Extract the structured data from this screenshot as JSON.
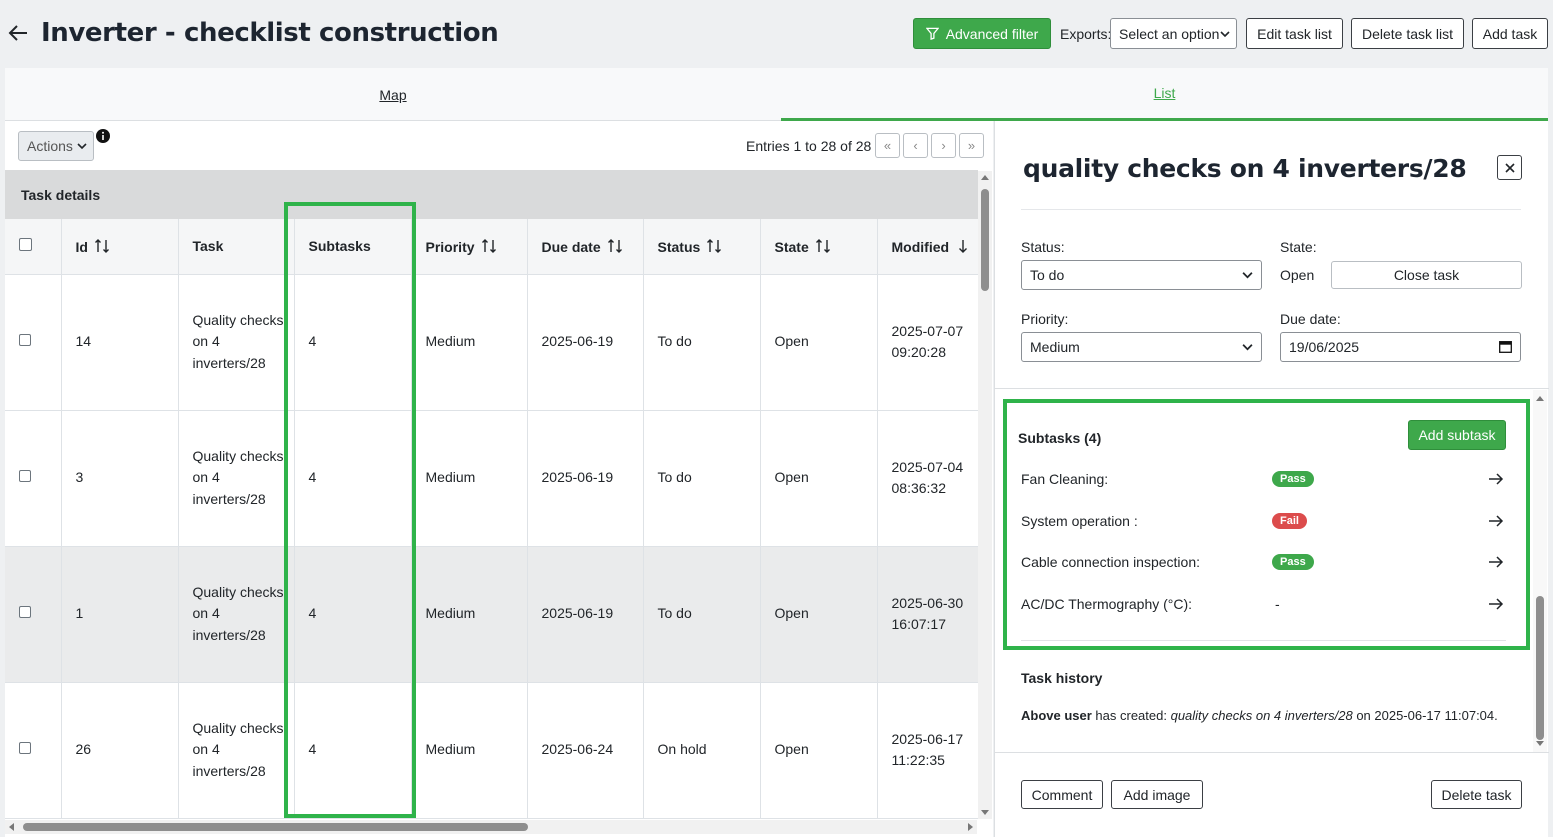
{
  "header": {
    "title": "Inverter - checklist construction",
    "advanced_filter": "Advanced filter",
    "exports_label": "Exports:",
    "exports_select": "Select an option",
    "edit_task_list": "Edit task list",
    "delete_task_list": "Delete task list",
    "add_task": "Add task"
  },
  "tabs": {
    "map": "Map",
    "list": "List"
  },
  "toolbar": {
    "actions": "Actions",
    "entries": "Entries 1 to 28 of 28",
    "pager": [
      "«",
      "‹",
      "›",
      "»"
    ]
  },
  "table": {
    "group_header": "Task details",
    "columns": {
      "id": "Id",
      "task": "Task",
      "subtasks": "Subtasks",
      "priority": "Priority",
      "due_date": "Due date",
      "status": "Status",
      "state": "State",
      "modified": "Modified"
    },
    "rows": [
      {
        "id": "14",
        "task": "Quality checks on 4 inverters/28",
        "subtasks": "4",
        "priority": "Medium",
        "due_date": "2025-06-19",
        "status": "To do",
        "state": "Open",
        "modified_date": "2025-07-07",
        "modified_time": "09:20:28"
      },
      {
        "id": "3",
        "task": "Quality checks on 4 inverters/28",
        "subtasks": "4",
        "priority": "Medium",
        "due_date": "2025-06-19",
        "status": "To do",
        "state": "Open",
        "modified_date": "2025-07-04",
        "modified_time": "08:36:32"
      },
      {
        "id": "1",
        "task": "Quality checks on 4 inverters/28",
        "subtasks": "4",
        "priority": "Medium",
        "due_date": "2025-06-19",
        "status": "To do",
        "state": "Open",
        "modified_date": "2025-06-30",
        "modified_time": "16:07:17"
      },
      {
        "id": "26",
        "task": "Quality checks on 4 inverters/28",
        "subtasks": "4",
        "priority": "Medium",
        "due_date": "2025-06-24",
        "status": "On hold",
        "state": "Open",
        "modified_date": "2025-06-17",
        "modified_time": "11:22:35"
      }
    ]
  },
  "detail": {
    "title": "quality checks on 4 inverters/28",
    "status_label": "Status:",
    "status_value": "To do",
    "state_label": "State:",
    "state_value": "Open",
    "close_task": "Close task",
    "priority_label": "Priority:",
    "priority_value": "Medium",
    "due_label": "Due date:",
    "due_value": "19/06/2025",
    "subtasks_title": "Subtasks (4)",
    "add_subtask": "Add subtask",
    "subtasks": [
      {
        "name": "Fan Cleaning:",
        "result": "Pass"
      },
      {
        "name": "System operation :",
        "result": "Fail"
      },
      {
        "name": "Cable connection inspection:",
        "result": "Pass"
      },
      {
        "name": "AC/DC Thermography (°C):",
        "result": "-"
      }
    ],
    "history_title": "Task history",
    "history_user": "Above user",
    "history_mid": " has created: ",
    "history_task": "quality checks on 4 inverters/28",
    "history_end": " on 2025-06-17 11:07:04.",
    "comment": "Comment",
    "add_image": "Add image",
    "delete_task": "Delete task"
  },
  "colors": {
    "accent": "#3ea84b",
    "pass": "#3ea84b",
    "fail": "#dc4c4c",
    "highlight": "#2fb34a"
  }
}
